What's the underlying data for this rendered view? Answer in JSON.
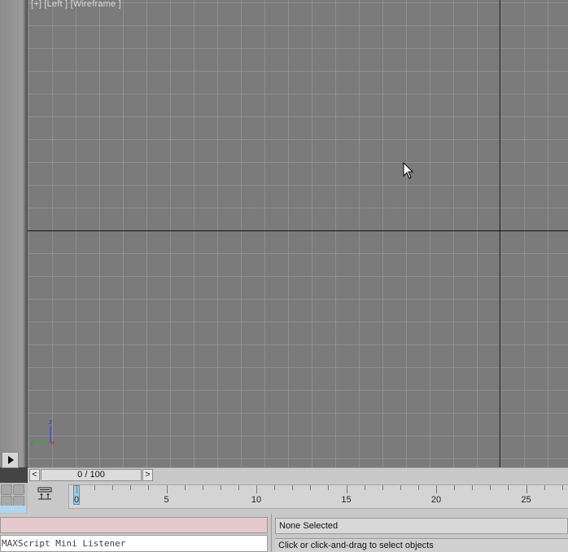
{
  "viewport": {
    "label": "[+] [Left ] [Wireframe ]",
    "gizmo": {
      "z": "z",
      "y": "y",
      "x": "x"
    }
  },
  "time_slider": {
    "prev_label": "<",
    "next_label": ">",
    "position_text": "0 / 100"
  },
  "track_bar": {
    "tick_labels": [
      "0",
      "5",
      "10",
      "15",
      "20",
      "25"
    ]
  },
  "maxscript": {
    "input_value": "",
    "output_text": "MAXScript Mini Listener"
  },
  "status": {
    "selection_text": "None Selected",
    "prompt_text": "Click or click-and-drag to select objects"
  },
  "colors": {
    "viewport_bg": "#7b7b7b",
    "grid": "#a0a0a0",
    "axis": "#111111",
    "panel": "#c8c8c8",
    "maxscript_input": "#e6c9cc",
    "frame_marker": "#9fcbe8"
  }
}
